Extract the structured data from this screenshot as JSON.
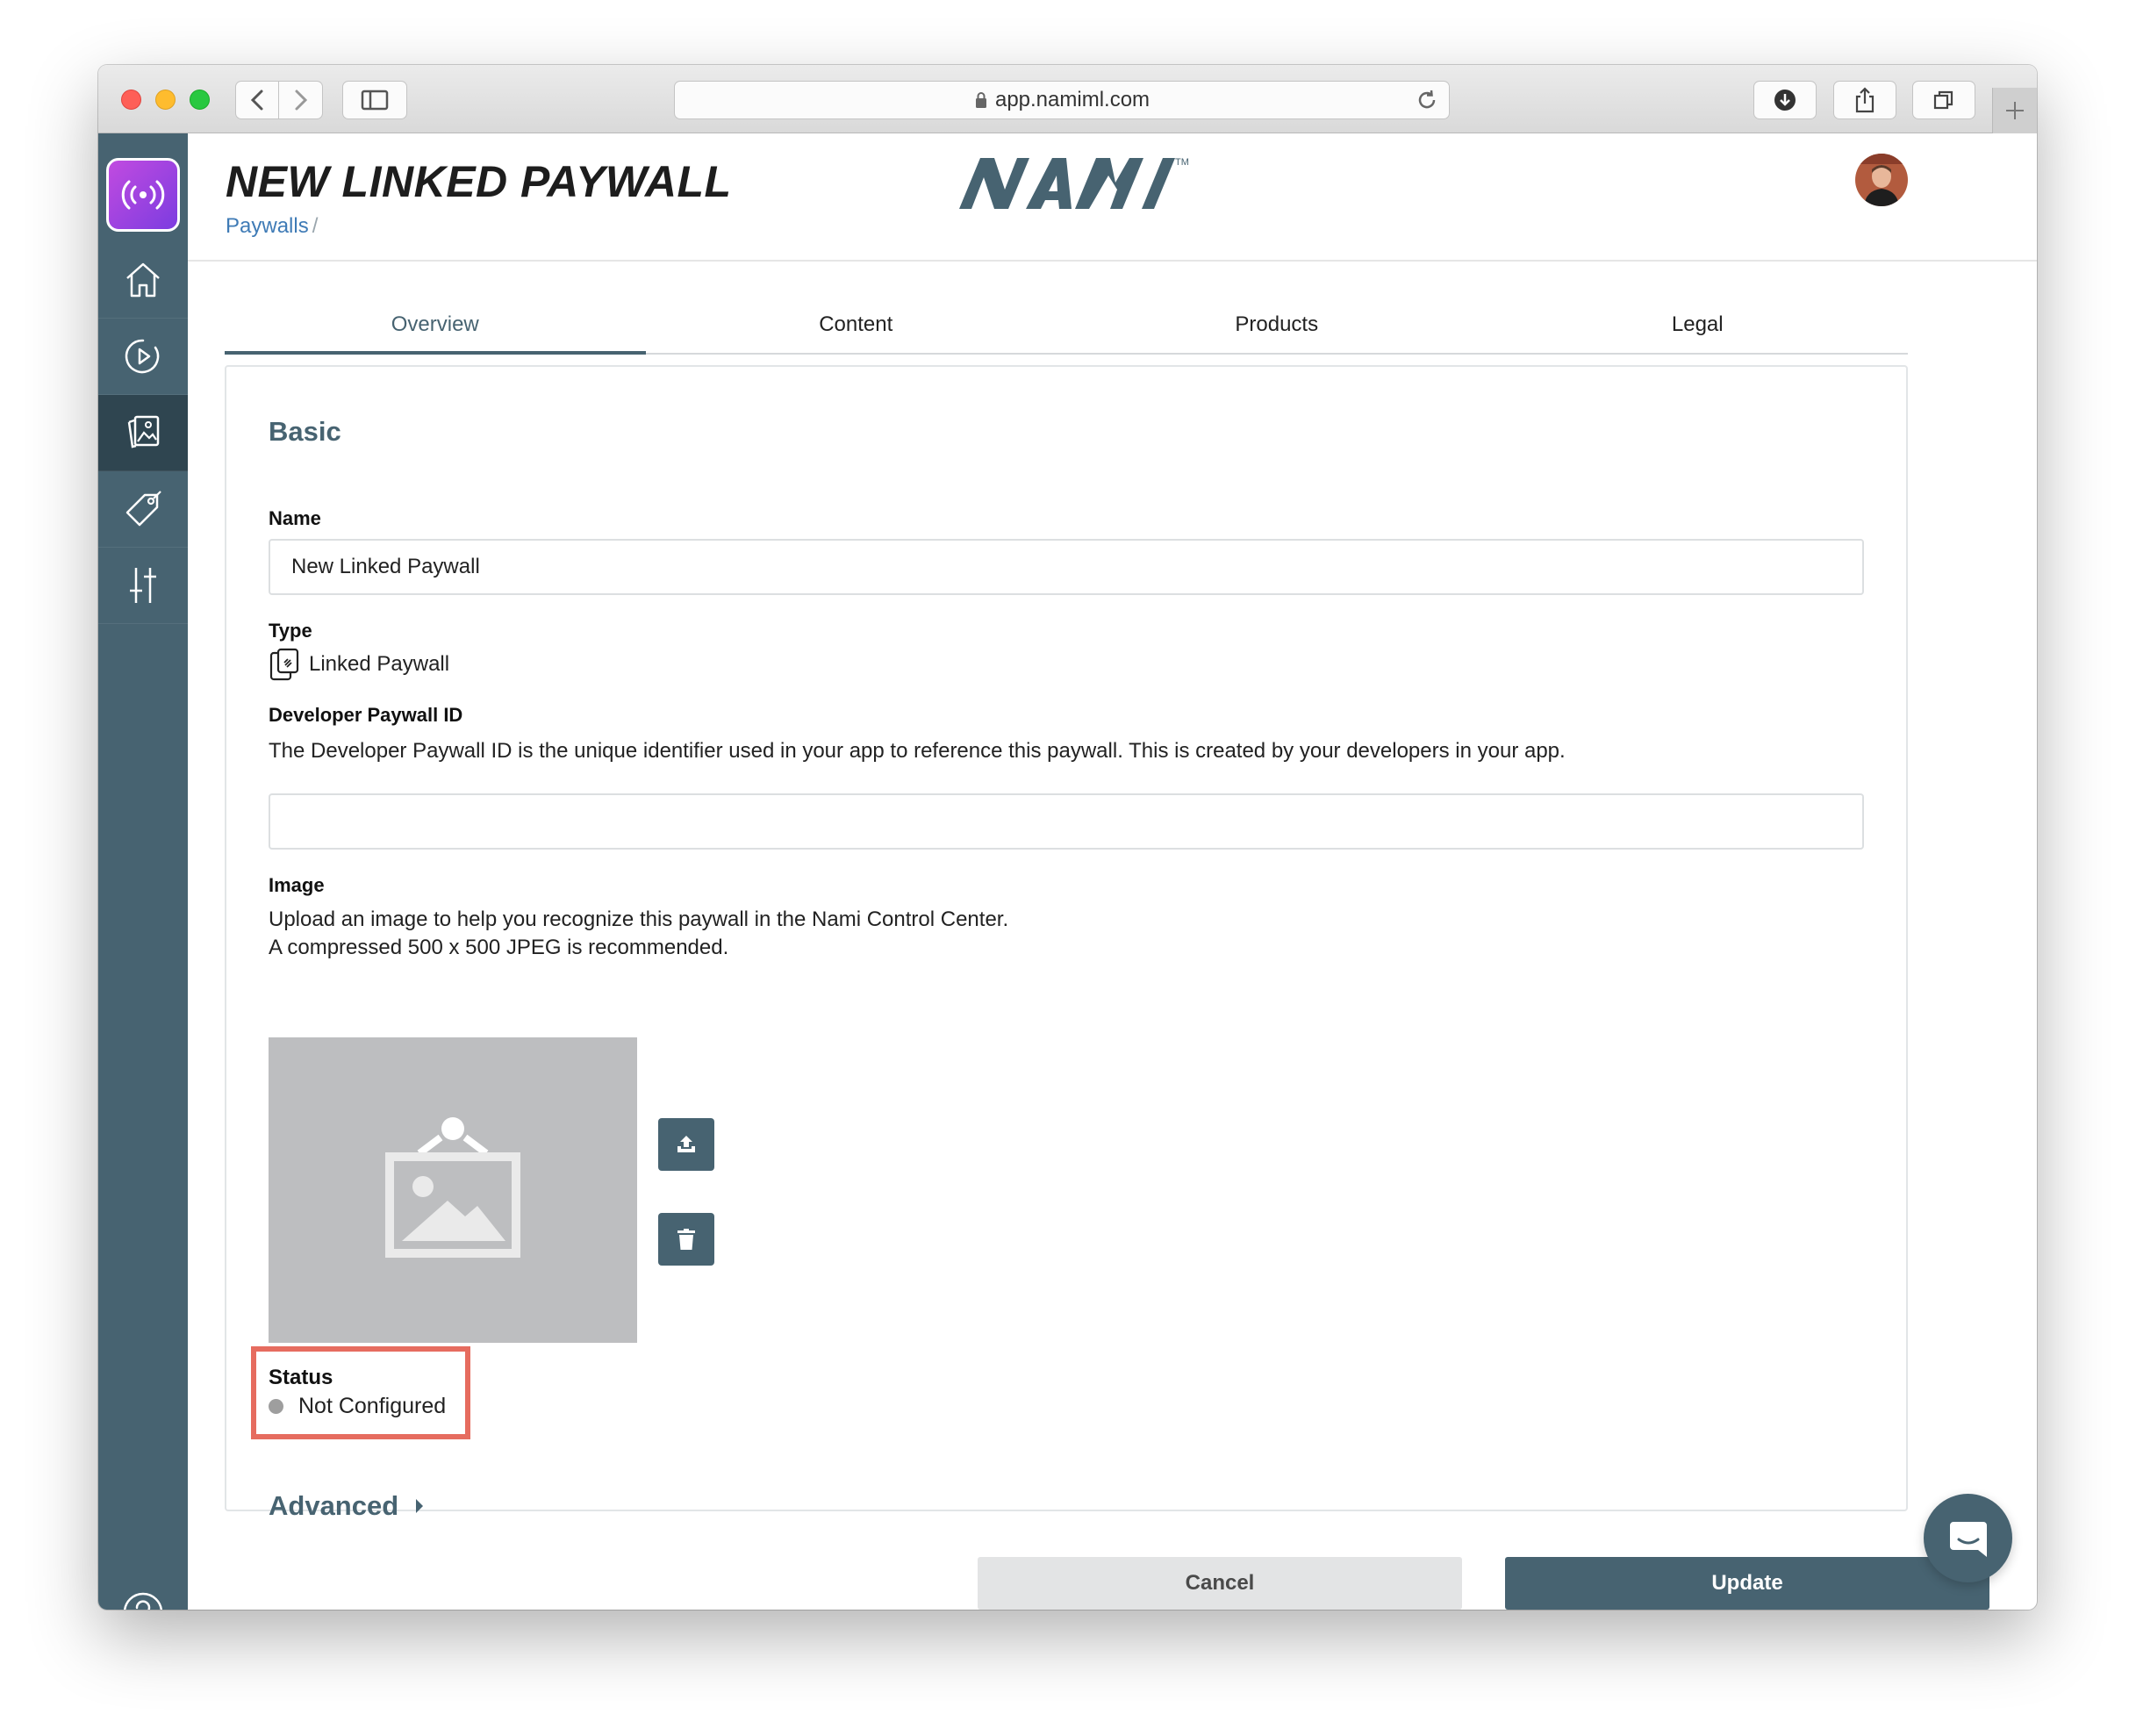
{
  "browser": {
    "url": "app.namiml.com"
  },
  "sidebar": {
    "items": [
      {
        "name": "home",
        "icon": "home-icon"
      },
      {
        "name": "campaigns",
        "icon": "play-circle-icon"
      },
      {
        "name": "paywalls",
        "icon": "image-cards-icon",
        "active": true
      },
      {
        "name": "products",
        "icon": "tag-icon"
      },
      {
        "name": "settings",
        "icon": "sliders-icon"
      }
    ],
    "help_icon": "question-circle-icon"
  },
  "header": {
    "title": "NEW LINKED PAYWALL",
    "breadcrumb": "Paywalls",
    "breadcrumb_sep": "/",
    "brand": "NAMI",
    "brand_tm": "TM"
  },
  "tabs": [
    {
      "label": "Overview",
      "active": true
    },
    {
      "label": "Content"
    },
    {
      "label": "Products"
    },
    {
      "label": "Legal"
    }
  ],
  "form": {
    "section_title": "Basic",
    "name_label": "Name",
    "name_value": "New Linked Paywall",
    "type_label": "Type",
    "type_value": "Linked Paywall",
    "dev_id_label": "Developer Paywall ID",
    "dev_id_help": "The Developer Paywall ID is the unique identifier used in your app to reference this paywall. This is created by your developers in your app.",
    "dev_id_value": "",
    "image_label": "Image",
    "image_help_1": "Upload an image to help you recognize this paywall in the Nami Control Center.",
    "image_help_2": "A compressed 500 x 500 JPEG is recommended.",
    "status_label": "Status",
    "status_value": "Not Configured",
    "advanced_label": "Advanced"
  },
  "footer": {
    "cancel_label": "Cancel",
    "update_label": "Update"
  },
  "colors": {
    "accent": "#476371",
    "highlight": "#e66c5f",
    "status_dot": "#9e9e9e"
  }
}
